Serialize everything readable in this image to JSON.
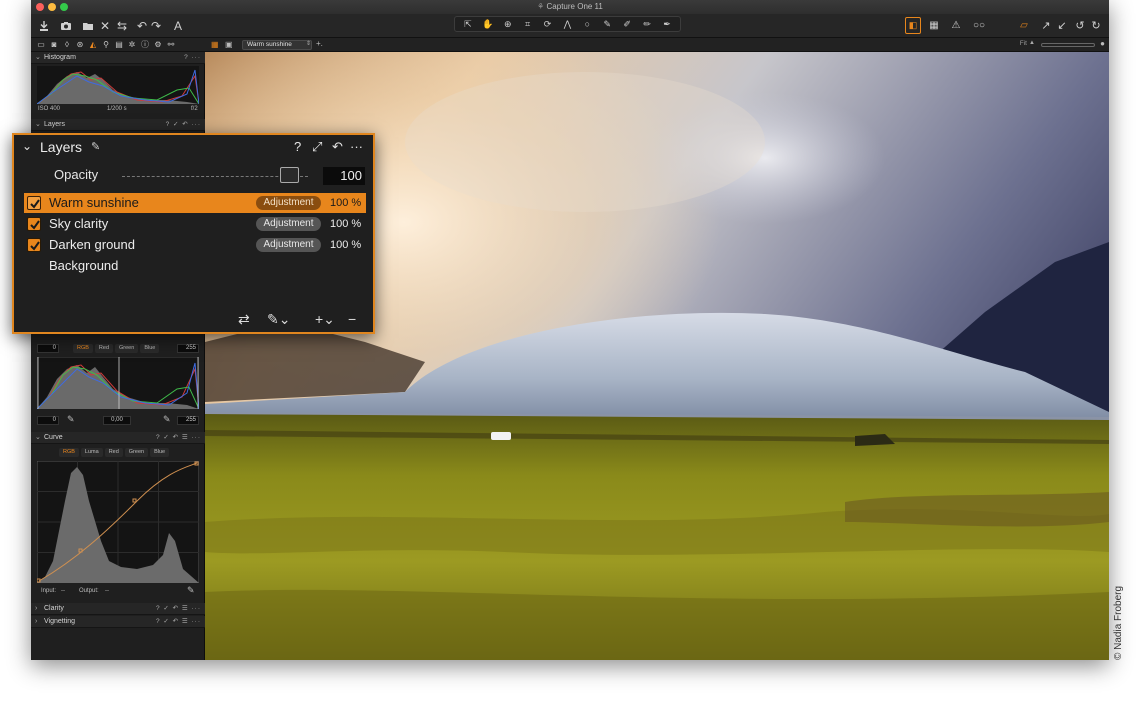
{
  "window": {
    "title": "Capture One 11"
  },
  "subbar": {
    "variant_name": "Warm sunshine",
    "fit_label": "Fit"
  },
  "left_panel": {
    "histogram": {
      "title": "Histogram",
      "iso": "ISO 400",
      "shutter": "1/200 s",
      "aperture": "f/2"
    },
    "layers": {
      "title": "Layers"
    },
    "levels": {
      "in_low": "0",
      "in_high": "255",
      "channels": [
        "RGB",
        "Red",
        "Green",
        "Blue"
      ],
      "out_low": "0",
      "mid": "0,00",
      "out_high": "255"
    },
    "curve": {
      "title": "Curve",
      "channels": [
        "RGB",
        "Luma",
        "Red",
        "Green",
        "Blue"
      ],
      "input_label": "Input:",
      "input_value": "--",
      "output_label": "Output:",
      "output_value": "--"
    },
    "clarity": {
      "title": "Clarity"
    },
    "vignetting": {
      "title": "Vignetting"
    }
  },
  "layers_popup": {
    "title": "Layers",
    "opacity_label": "Opacity",
    "opacity_value": "100",
    "opacity_fraction": 0.9,
    "rows": [
      {
        "name": "Warm sunshine",
        "badge": "Adjustment",
        "opacity": "100 %",
        "selected": true,
        "checked": true
      },
      {
        "name": "Sky clarity",
        "badge": "Adjustment",
        "opacity": "100 %",
        "selected": false,
        "checked": true
      },
      {
        "name": "Darken ground",
        "badge": "Adjustment",
        "opacity": "100 %",
        "selected": false,
        "checked": true
      },
      {
        "name": "Background",
        "badge": "",
        "opacity": "",
        "selected": false,
        "checked": false
      }
    ]
  },
  "credit": "© Nadia Froberg",
  "colors": {
    "accent": "#e8861c",
    "panel": "#1f1f1f",
    "text": "#ececec"
  }
}
